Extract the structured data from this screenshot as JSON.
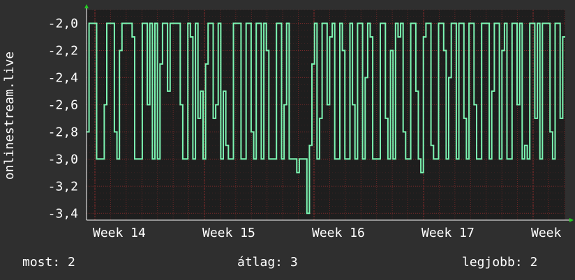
{
  "colors": {
    "background": "#2f2f2f",
    "plot_background": "#1e1e1e",
    "grid": "#7a2a2a",
    "line": "#7cf5b2",
    "text": "#ffffff",
    "arrow": "#22cc22"
  },
  "chart_data": {
    "type": "line",
    "ylabel": "onlinestream.live",
    "ylim": [
      -3.45,
      -1.9
    ],
    "y_ticks": [
      -2.0,
      -2.2,
      -2.4,
      -2.6,
      -2.8,
      -3.0,
      -3.2,
      -3.4
    ],
    "y_tick_labels": [
      "-2,0",
      "-2,2",
      "-2,4",
      "-2,6",
      "-2,8",
      "-3,0",
      "-3,2",
      "-3,4"
    ],
    "x_ticks": [
      "Week 14",
      "Week 15",
      "Week 16",
      "Week 17",
      "Week"
    ],
    "grid": true,
    "series": [
      {
        "values": [
          -2.8,
          -2.0,
          -2.0,
          -2.0,
          -3.0,
          -3.0,
          -3.0,
          -2.6,
          -2.0,
          -2.0,
          -2.0,
          -2.8,
          -3.0,
          -2.2,
          -2.0,
          -2.0,
          -2.0,
          -2.0,
          -2.1,
          -3.0,
          -3.0,
          -3.0,
          -2.0,
          -2.0,
          -2.6,
          -2.0,
          -3.0,
          -2.0,
          -3.0,
          -2.3,
          -2.0,
          -2.0,
          -2.5,
          -2.0,
          -2.0,
          -2.0,
          -2.0,
          -2.6,
          -3.0,
          -3.0,
          -2.0,
          -2.1,
          -3.0,
          -2.0,
          -2.7,
          -2.5,
          -3.0,
          -2.3,
          -2.0,
          -2.0,
          -2.7,
          -2.6,
          -2.0,
          -3.0,
          -2.5,
          -2.9,
          -3.0,
          -3.0,
          -2.0,
          -2.0,
          -2.0,
          -3.0,
          -3.0,
          -2.0,
          -2.0,
          -2.8,
          -3.0,
          -2.0,
          -2.0,
          -3.0,
          -2.0,
          -2.2,
          -3.0,
          -3.0,
          -3.0,
          -2.0,
          -2.0,
          -3.0,
          -2.6,
          -2.0,
          -3.0,
          -3.0,
          -3.0,
          -3.1,
          -3.0,
          -3.0,
          -3.0,
          -3.4,
          -2.9,
          -2.3,
          -2.0,
          -3.0,
          -2.7,
          -2.0,
          -2.0,
          -2.6,
          -2.1,
          -2.0,
          -3.0,
          -3.0,
          -2.0,
          -2.2,
          -3.0,
          -3.0,
          -2.0,
          -2.6,
          -3.0,
          -2.0,
          -2.0,
          -3.0,
          -2.4,
          -2.0,
          -2.1,
          -3.0,
          -3.0,
          -3.0,
          -2.0,
          -2.0,
          -2.7,
          -3.0,
          -2.2,
          -3.0,
          -2.0,
          -2.1,
          -2.0,
          -2.8,
          -3.0,
          -3.0,
          -2.0,
          -2.0,
          -2.5,
          -3.0,
          -3.1,
          -2.1,
          -2.0,
          -2.0,
          -2.9,
          -3.0,
          -3.0,
          -2.0,
          -2.0,
          -2.2,
          -3.0,
          -2.4,
          -2.0,
          -2.0,
          -3.0,
          -2.0,
          -2.0,
          -2.7,
          -3.0,
          -2.0,
          -2.0,
          -2.6,
          -3.0,
          -3.0,
          -2.0,
          -2.0,
          -2.0,
          -3.0,
          -2.5,
          -2.0,
          -2.0,
          -3.0,
          -2.2,
          -2.0,
          -3.0,
          -3.0,
          -2.0,
          -2.0,
          -2.6,
          -2.0,
          -3.0,
          -2.9,
          -3.0,
          -2.0,
          -2.0,
          -2.7,
          -2.0,
          -3.0,
          -2.0,
          -2.0,
          -2.0,
          -2.8,
          -3.0,
          -2.0,
          -2.0,
          -2.7,
          -2.1
        ]
      }
    ]
  },
  "legend": {
    "most": "most: 2",
    "atlag": "átlag: 3",
    "legjobb": "legjobb: 2"
  }
}
